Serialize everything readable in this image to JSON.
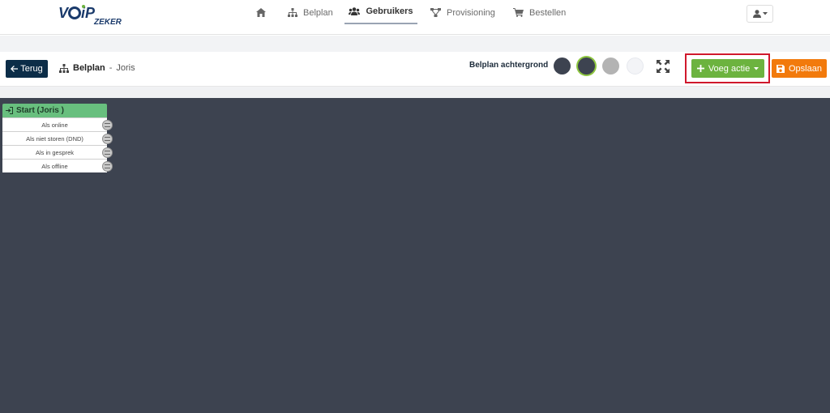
{
  "brand": {
    "logo_text": "VOiP",
    "logo_sub": "ZEKER"
  },
  "nav": {
    "items": [
      {
        "label": "",
        "icon": "home-icon"
      },
      {
        "label": "Belplan",
        "icon": "sitemap-icon"
      },
      {
        "label": "Gebruikers",
        "icon": "users-icon",
        "active": true
      },
      {
        "label": "Provisioning",
        "icon": "network-icon"
      },
      {
        "label": "Bestellen",
        "icon": "cart-icon"
      }
    ],
    "user_icon": "user-icon"
  },
  "toolbar": {
    "back_label": "Terug",
    "breadcrumb_section": "Belplan",
    "breadcrumb_sep": "-",
    "breadcrumb_name": "Joris",
    "background_label": "Belplan achtergrond",
    "swatches": [
      "#3d4350",
      "#3d4350",
      "#b3b3b3",
      "#f3f4f7"
    ],
    "selected_swatch": 1,
    "add_label": "Voeg actie",
    "save_label": "Opslaan",
    "colors": {
      "back": "#0c2d48",
      "add": "#6cb33f",
      "save": "#f27a0c",
      "highlight": "#d0182c"
    }
  },
  "flow": {
    "node_title": "Start (Joris )",
    "rows": [
      "Als online",
      "Als niet storen (DND)",
      "Als in gesprek",
      "Als offline"
    ]
  }
}
